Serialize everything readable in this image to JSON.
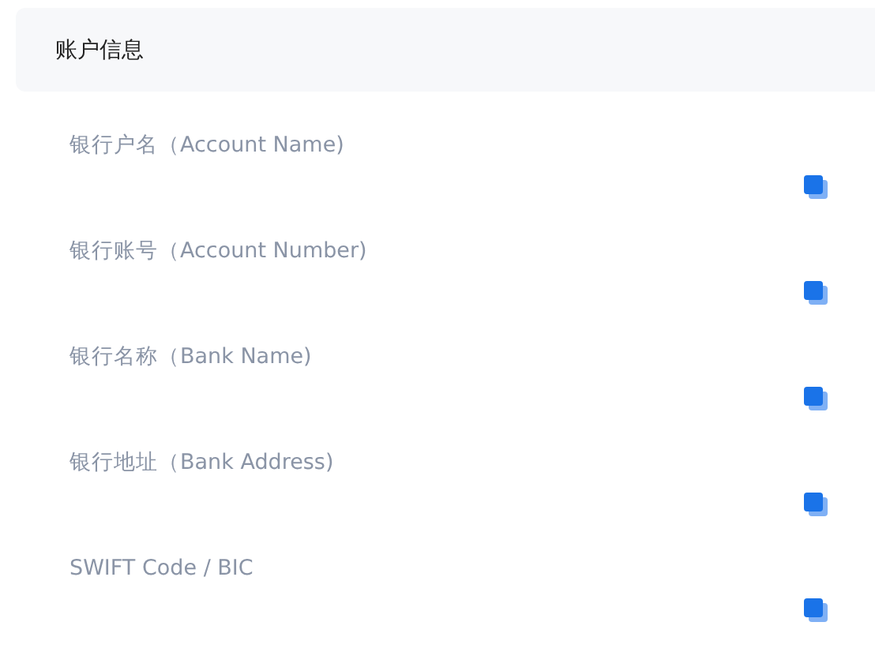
{
  "section": {
    "title": "账户信息"
  },
  "fields": [
    {
      "label": "银行户名（Account Name)"
    },
    {
      "label": "银行账号（Account Number)"
    },
    {
      "label": "银行名称（Bank Name)"
    },
    {
      "label": "银行地址（Bank Address)"
    },
    {
      "label": "SWIFT Code / BIC"
    }
  ]
}
